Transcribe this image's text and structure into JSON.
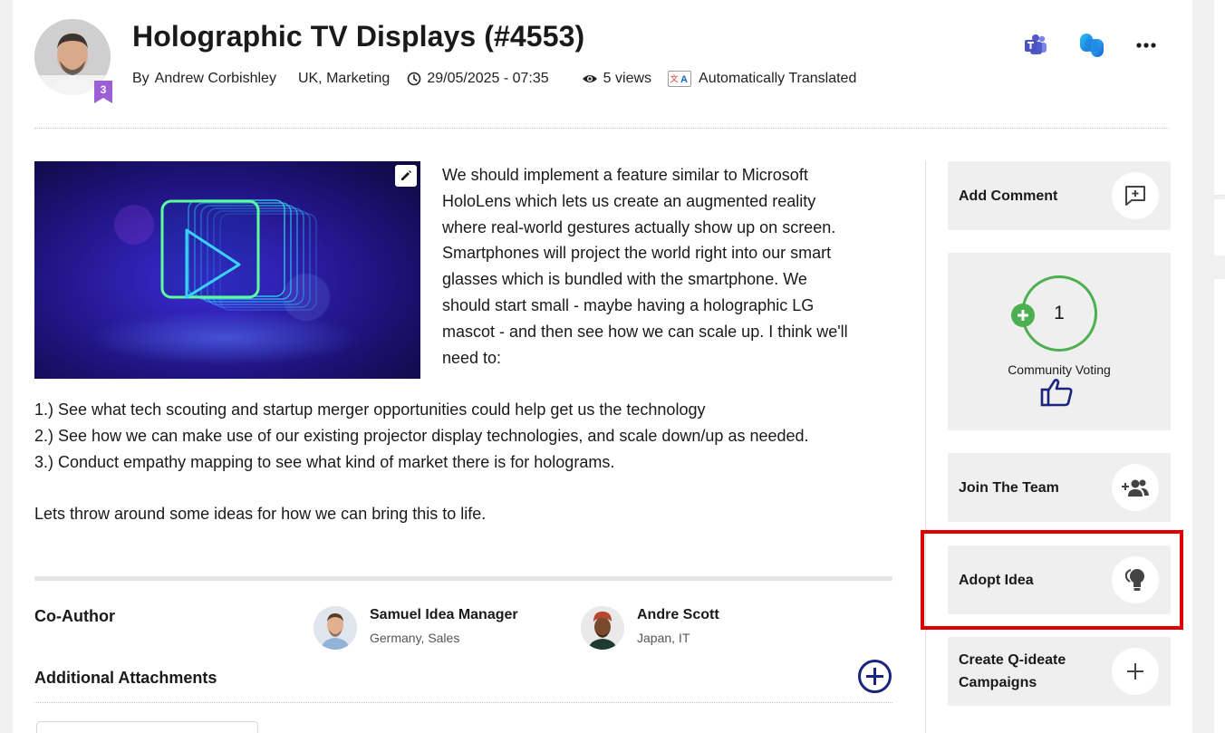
{
  "idea": {
    "title": "Holographic TV Displays (#4553)",
    "by_label": "By",
    "author": "Andrew Corbishley",
    "department": "UK, Marketing",
    "datetime": "29/05/2025 - 07:35",
    "views": "5 views",
    "translated": "Automatically Translated",
    "author_badge": "3"
  },
  "header_icons": [
    "teams-icon",
    "copilot-icon",
    "more-icon"
  ],
  "description": [
    "We should implement a feature similar to Microsoft",
    "HoloLens which lets us create an augmented reality",
    "where real-world gestures actually show up on screen.",
    "Smartphones will project the world right into our smart",
    "glasses which is bundled with the smartphone. We",
    "should start small - maybe having a holographic LG",
    "mascot - and then see how we can scale up. I think we'll",
    "need to:"
  ],
  "list": [
    "1.) See what tech scouting and startup merger opportunities could help get us the technology",
    "2.) See how we can make use of our existing projector display technologies, and scale down/up as needed.",
    "3.) Conduct empathy mapping to see what kind of market there is for holograms."
  ],
  "closing": "Lets throw around some ideas for how we can bring this to life.",
  "coauthor": {
    "label": "Co-Author",
    "people": [
      {
        "name": "Samuel Idea Manager",
        "dept": "Germany, Sales"
      },
      {
        "name": "Andre Scott",
        "dept": "Japan, IT"
      }
    ]
  },
  "attachments": {
    "label": "Additional Attachments"
  },
  "actions": {
    "add_comment": "Add Comment",
    "voting_count": "1",
    "voting_label": "Community Voting",
    "join_team": "Join The Team",
    "adopt_idea": "Adopt Idea",
    "create_campaign_line1": "Create Q-ideate",
    "create_campaign_line2": "Campaigns"
  },
  "colors": {
    "accent": "#1a237e",
    "vote_green": "#4caf50",
    "highlight": "#e00000",
    "badge_purple": "#9c5fd6"
  }
}
